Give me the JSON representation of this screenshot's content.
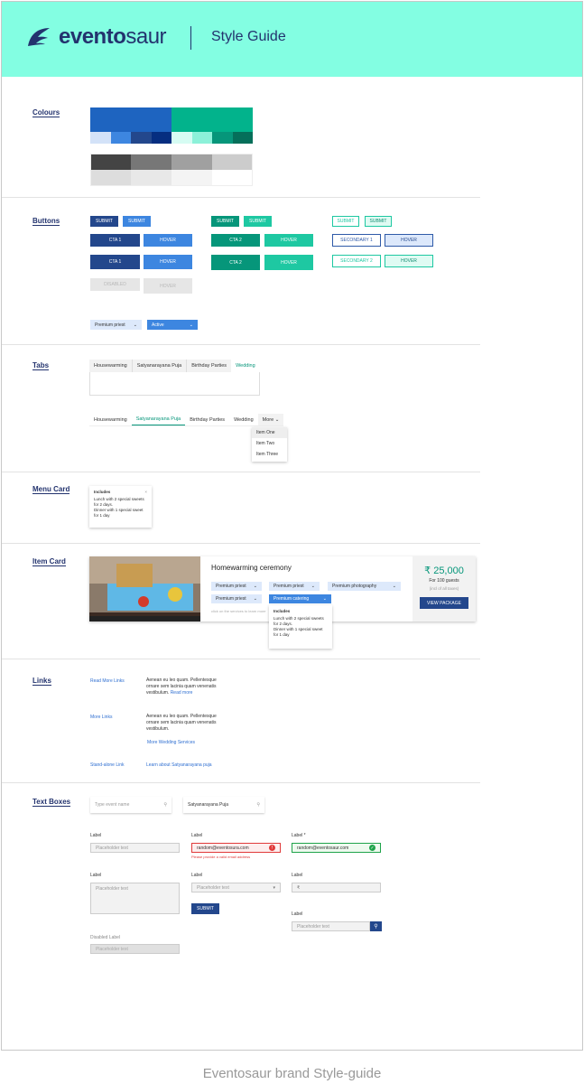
{
  "header": {
    "brand_bold": "evento",
    "brand_light": "saur",
    "title": "Style Guide"
  },
  "sections": {
    "colours": "Colours",
    "buttons": "Buttons",
    "tabs": "Tabs",
    "menu_card": "Menu Card",
    "item_card": "Item Card",
    "links": "Links",
    "text_boxes": "Text Boxes"
  },
  "colors": {
    "primary": "#1e64c0",
    "accent": "#02b38c",
    "navy": "#23336e",
    "mint": "#83fee2",
    "primary_shades": [
      "#d3e2f8",
      "#3d86e0",
      "#23478c",
      "#062e80"
    ],
    "accent_shades": [
      "#d6fcf3",
      "#8cf1d9",
      "#06967a",
      "#056f5a"
    ],
    "greys": [
      "#444444",
      "#777777",
      "#a0a0a0",
      "#cccccc"
    ],
    "light_greys": [
      "#dddddd",
      "#e8e8e8",
      "#f4f4f4",
      "#ffffff"
    ]
  },
  "buttons": {
    "submit": "SUBMIT",
    "cta1": "CTA 1",
    "cta2": "CTA 2",
    "hover": "HOVER",
    "secondary1": "SECONDARY 1",
    "secondary2": "SECONDARY 2",
    "disabled": "DISABLED",
    "dd_premium": "Premium priest",
    "dd_active": "Active"
  },
  "tabs": {
    "row1": [
      "Housewarming",
      "Satyanarayana Puja",
      "Birthday Parties",
      "Wedding"
    ],
    "row2": [
      "Housewarming",
      "Satyanarayana Puja",
      "Birthday Parties",
      "Wedding",
      "More"
    ],
    "menu": [
      "Item One",
      "Item Two",
      "Item Three"
    ]
  },
  "menu_card": {
    "heading": "Includes",
    "close": "×",
    "items": [
      "Lunch with 2 special sweets for 2 days.",
      "Dinner with 1 special sweet for 1 day"
    ]
  },
  "item_card": {
    "title": "Homewarming ceremony",
    "options": [
      "Premium priest",
      "Premium priest",
      "Premium photography",
      "Premium priest",
      "Premium catering"
    ],
    "hint": "click on the services to learn more",
    "price": "₹ 25,000",
    "guests": "For 100 guests",
    "tax": "(incl of all taxes)",
    "cta": "VIEW PACKAGE",
    "popup_heading": "Includes",
    "popup_items": [
      "Lunch with 2 special sweets for 2 days.",
      "Dinner with 1 special sweet for 1 day"
    ]
  },
  "links": {
    "read_more_label": "Read More Links",
    "read_more_body": "Aenean eu leo quam. Pellentesque ornare sem lacinia quam venenatis vestibulum.",
    "read_more_link": "Read more",
    "more_label": "More Links",
    "more_body": "Aenean eu leo quam. Pellentesque ornare sem lacinia quam venenatis vestibulum.",
    "more_link": "More Wedding Services",
    "standalone_label": "Stand-alone Link",
    "standalone_link": "Learn about Satyanarayana puja"
  },
  "textboxes": {
    "search_placeholder": "Type event name",
    "search_value": "Satyanarayana Puja",
    "label": "Label",
    "label_required": "Label *",
    "placeholder": "Placeholder text",
    "email_error": "random@eventosura.com",
    "email_ok": "random@eventosaur.com",
    "error_msg": "Please provide a valid email address",
    "submit": "SUBMIT",
    "rupee": "₹",
    "disabled_label": "Disabled Label"
  },
  "caption": "Eventosaur brand Style-guide"
}
